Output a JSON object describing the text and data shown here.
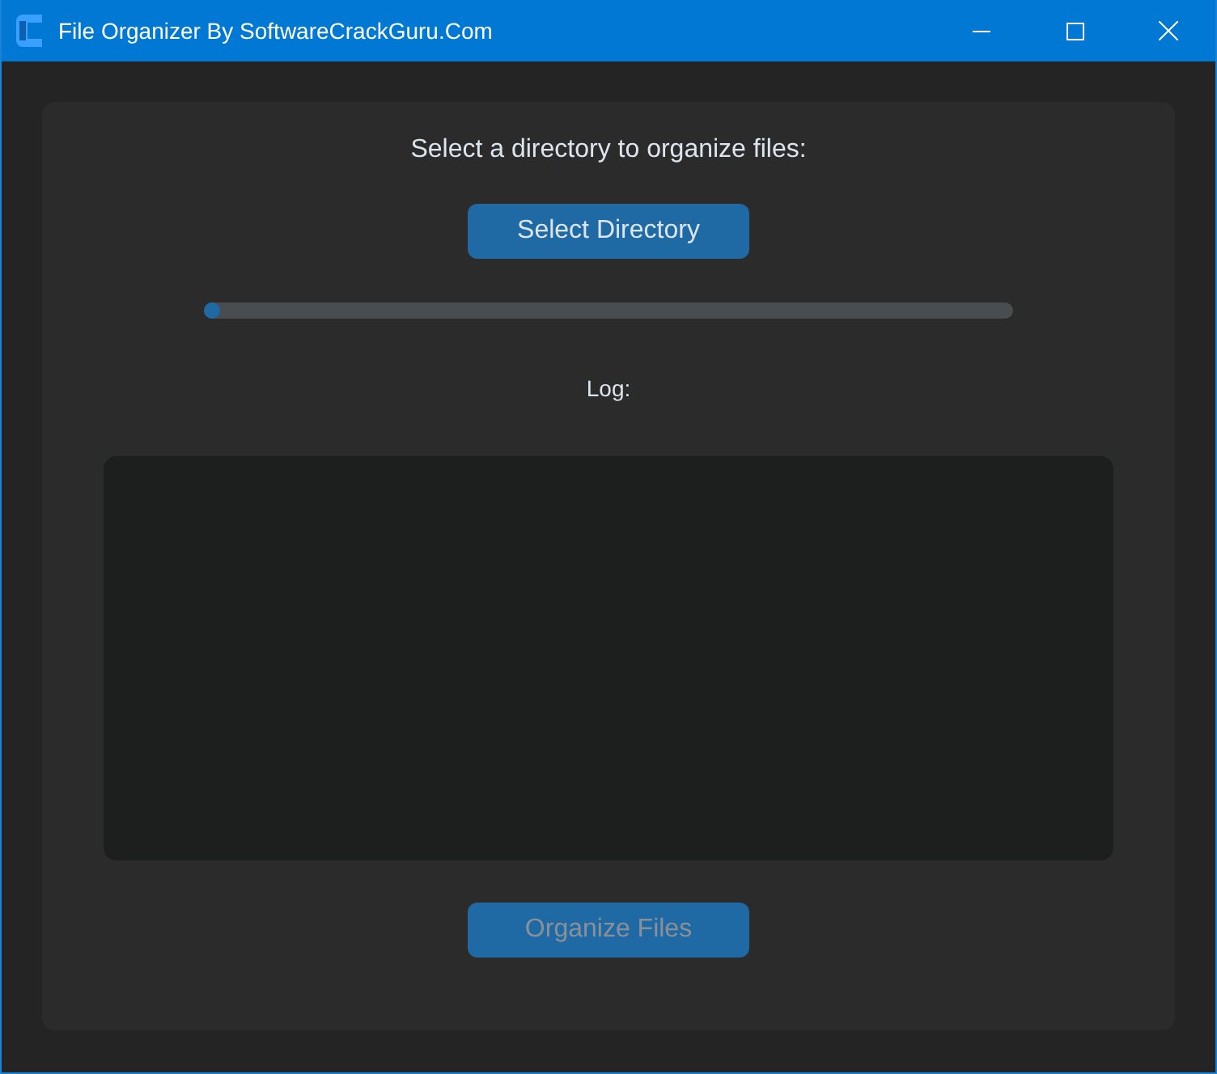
{
  "window": {
    "title": "File Organizer By SoftwareCrackGuru.Com"
  },
  "heading": "Select a directory to organize files:",
  "select_button": {
    "label": "Select Directory",
    "disabled": false
  },
  "progress": {
    "level": 0
  },
  "log_label": "Log:",
  "organize_button": {
    "label": "Organize Files",
    "disabled": true
  }
}
